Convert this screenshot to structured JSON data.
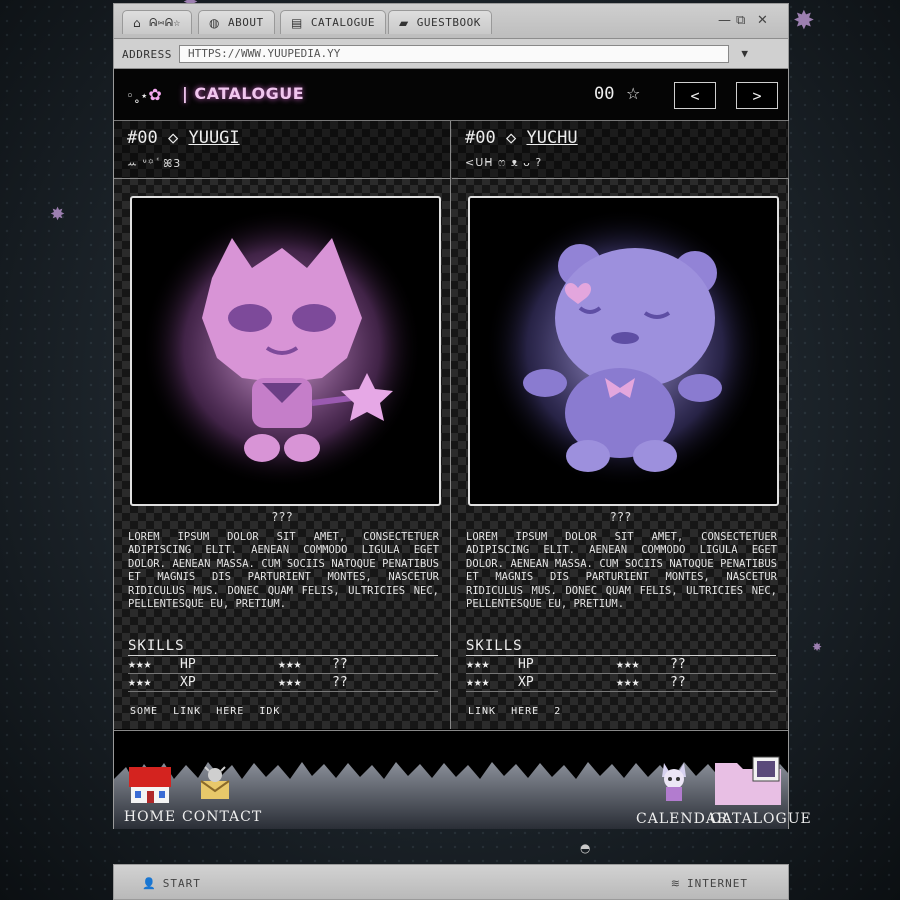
{
  "browser": {
    "tabs": [
      {
        "icon": "home-icon",
        "label": "ᕱ⑅ᕱ☆"
      },
      {
        "icon": "globe-icon",
        "label": "ABOUT"
      },
      {
        "icon": "document-icon",
        "label": "CATALOGUE"
      },
      {
        "icon": "chat-icon",
        "label": "GUESTBOOK"
      }
    ],
    "window_controls": {
      "minimize": "—",
      "restore": "⧉",
      "close": "✕"
    },
    "address_label": "ADDRESS",
    "address_value": "HTTPS://WWW.YUUPEDIA.YY",
    "address_dropdown": "▼"
  },
  "header": {
    "deco": "◦˳⋆",
    "title": "| CATALOGUE",
    "count": "00",
    "star": "☆",
    "prev": "<",
    "next": ">"
  },
  "entries": [
    {
      "number": "#00",
      "diamond": "◇",
      "name": "YUUGI",
      "glyphs": "ꕀ ᐡ꙳ ꙴ ꕤ3",
      "caption": "???",
      "description": "Lorem ipsum dolor sit amet, consectetuer adipiscing elit. Aenean commodo ligula eget dolor. Aenean massa. Cum sociis natoque penatibus et magnis dis parturient montes, nascetur ridiculus mus. Donec quam felis, ultricies nec, pellentesque eu, pretium.",
      "skills_title": "SKILLS",
      "skills": [
        {
          "stars": "★★★",
          "name": "HP",
          "stars2": "★★★",
          "value": "??"
        },
        {
          "stars": "★★★",
          "name": "XP",
          "stars2": "★★★",
          "value": "??"
        }
      ],
      "links": [
        "SOME",
        "LINK",
        "HERE",
        "IDK"
      ],
      "accent": "#d9a2e0"
    },
    {
      "number": "#00",
      "diamond": "◇",
      "name": "YUCHU",
      "glyphs": "<ᑌᕼ ෆ ᴥ ᴗ ?",
      "caption": "???",
      "description": "Lorem ipsum dolor sit amet, consectetuer adipiscing elit. Aenean commodo ligula eget dolor. Aenean massa. Cum sociis natoque penatibus et magnis dis parturient montes, nascetur ridiculus mus. Donec quam felis, ultricies nec, pellentesque eu, pretium.",
      "skills_title": "SKILLS",
      "skills": [
        {
          "stars": "★★★",
          "name": "HP",
          "stars2": "★★★",
          "value": "??"
        },
        {
          "stars": "★★★",
          "name": "XP",
          "stars2": "★★★",
          "value": "??"
        }
      ],
      "links": [
        "LINK",
        "HERE",
        "2"
      ],
      "accent": "#9b8fe0"
    }
  ],
  "dock": {
    "home": "HOME",
    "contact": "CONTACT",
    "calendar": "CALENDAR",
    "catalogue": "CATALOGUE"
  },
  "taskbar": {
    "start": "START",
    "internet": "INTERNET"
  }
}
